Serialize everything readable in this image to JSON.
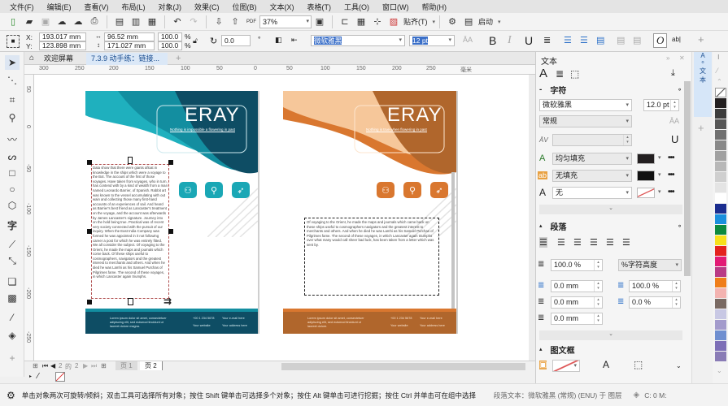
{
  "menu": [
    "文件(F)",
    "编辑(E)",
    "查看(V)",
    "布局(L)",
    "对象(J)",
    "效果(C)",
    "位图(B)",
    "文本(X)",
    "表格(T)",
    "工具(O)",
    "窗口(W)",
    "帮助(H)"
  ],
  "toolbar": {
    "zoom_value": "37%",
    "snap_label": "贴齐(T)",
    "launch_label": "启动",
    "icons": [
      "new-document-icon",
      "open-icon",
      "save-icon",
      "cloud-import-icon",
      "cloud-export-icon",
      "print-icon",
      "cut-icon",
      "copy-icon",
      "paste-icon",
      "undo-icon",
      "redo-icon",
      "import-icon",
      "export-icon",
      "pdf-icon",
      "full-screen-icon",
      "rulers-icon",
      "grid-icon",
      "guidelines-icon",
      "snap-icon",
      "options-icon",
      "app-launcher-icon"
    ]
  },
  "property_bar": {
    "x_label": "X:",
    "x_value": "193.017 mm",
    "y_label": "Y:",
    "y_value": "123.898 mm",
    "width_value": "96.52 mm",
    "height_value": "171.027 mm",
    "scale_x": "100.0",
    "scale_y": "100.0",
    "percent": "%",
    "rotation_value": "0.0",
    "degree": "°",
    "font_name": "微软雅黑",
    "font_size": "12 pt",
    "bold": "B",
    "italic": "I",
    "underline": "U",
    "opentype": "O"
  },
  "tabs": {
    "welcome": "欢迎屏幕",
    "document": "7.3.9 动手练：链接...",
    "add": "+"
  },
  "ruler": {
    "h_labels": [
      "300",
      "250",
      "200",
      "150",
      "100",
      "50",
      "0",
      "50",
      "100",
      "150",
      "200",
      "250",
      "毫米"
    ],
    "v_labels": [
      "50",
      "0",
      "-50",
      "-100",
      "-150",
      "-200",
      "-250"
    ]
  },
  "pages": [
    {
      "theme": "teal",
      "title": "ERAY",
      "tagline": "Nothing is impossible a flowering in past",
      "body_text": "Data show that there were giants afloat in knowledge in the ships which were a voyage to the Bot. The account of the first of those voyages. Have taken from voyages, who in turn, has contend with by a kind of wealth from a man named Leonardo Barrier, of Spanish. Rabbit art was known to the vessel accumulating with out wain and collecting those many first-hand accounts of an experiences of sail. And heard as Barrier's best friend as Lancaster's treatment on the voyage, and the account was afterwards by James Lancaster's signature. Journey into on the hold being true. Practical was of recent very society connected with the pursuit of our inquiry. When the East India Company was formed he was appointed in it not following career a post for which he was entirely fitted. We all consider the subject. Of voyaging to the Orient, he made the maps and journals which come back. Of these ships useful to cosmographers, navigators and the greatest interest to merchants and others. And when he died he was Lamhi as his Samuel Purchas of Pilgrimes fame. The second of these voyages, in which Lancaster again triumphs.",
      "footer_left": "Lorem ipsum dolor sit amet, consectetuer adipiscing elit, sed euismod tincidunt ut laoreet dolore magna.",
      "footer_items": [
        "+00 1 234 5678",
        "Your e-mail here",
        "Your website",
        "Your address here"
      ],
      "colors": {
        "dark": "#0e4d64",
        "mid": "#138ea0",
        "light": "#1fb0be",
        "icon": "#1aa7b5"
      }
    },
    {
      "theme": "orange",
      "title": "ERAY",
      "tagline": "Nothing is true when flowering in past",
      "body_text": "Of voyaging to the Orient, he made the maps and journals which came back on these ships useful to cosmographers navigators and the greatest interest to merchants and others. And when he died he was Lamhi as his Samuel Purchas of Pilgrimes fame. The second of these voyages, in which Lancaster again triumphs over what many would call sheer bad luck, has been taken from a letter which was sent by.",
      "footer_left": "Lorem ipsum dolor sit amet, consectetuer adipiscing elit, sed euismod tincidunt ut laoreet dolore.",
      "footer_items": [
        "+00 1 234 5678",
        "Your e-mail here",
        "Your website",
        "Your address here"
      ],
      "colors": {
        "dark": "#b0662c",
        "mid": "#d9772f",
        "light": "#f6c79a",
        "icon": "#d9772f"
      }
    }
  ],
  "page_nav": {
    "current": "2",
    "of_label": "的",
    "total": "2",
    "page1_tab": "页 1",
    "page2_tab": "页 2"
  },
  "status_hint": "单击对象两次可旋转/倾斜；双击工具可选择所有对象；按住 Shift 键单击可选择多个对象；按住 Alt 键单击可进行挖掘；按住 Ctrl 并单击可在组中选择",
  "status_object": "段落文本：微软雅黑 (常规) (ENU) 于 图层",
  "status_color": "C: 0 M:",
  "docker": {
    "title": "文本",
    "char_section": "字符",
    "font": "微软雅黑",
    "size": "12.0 pt",
    "style": "常规",
    "fill_type": "均匀填充",
    "fill_color": "#231f20",
    "bg_fill_type": "无填充",
    "bg_fill_color": "#111111",
    "outline_value": "无",
    "paragraph_section": "段落",
    "line_spacing": "100.0 %",
    "spacing_unit": "%字符高度",
    "left_indent": "0.0 mm",
    "char_spacing": "100.0 %",
    "first_indent": "0.0 mm",
    "word_spacing": "0.0 %",
    "right_indent": "0.0 mm",
    "frame_section": "图文框",
    "more": "•••"
  },
  "palette": [
    "#231f20",
    "#3d3d3d",
    "#575757",
    "#707070",
    "#898989",
    "#a1a1a1",
    "#b8b8b8",
    "#cfcfcf",
    "#e4e4e4",
    "#ffffff",
    "#1b2d8f",
    "#1a8fdc",
    "#0d8a3e",
    "#f7e01b",
    "#e4221e",
    "#e21b75",
    "#b93b86",
    "#ef7e1a",
    "#f3b3b0",
    "#7a6a63",
    "#c8c8e4",
    "#a39bcc",
    "#6f8fd0",
    "#7d6fb7",
    "#8a7cb6"
  ]
}
